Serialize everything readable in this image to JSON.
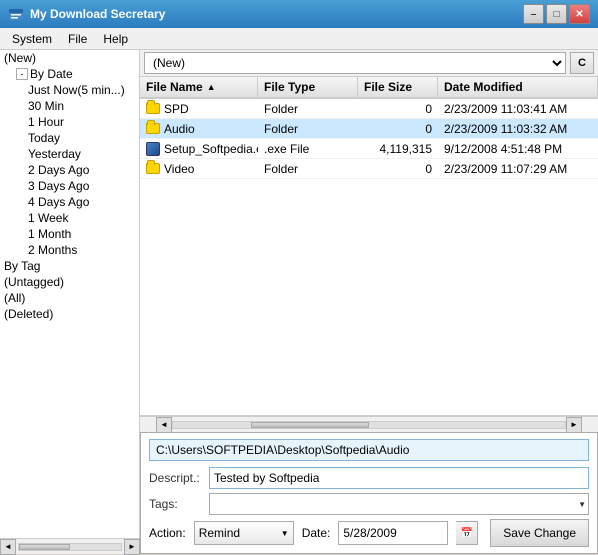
{
  "window": {
    "title": "My Download Secretary",
    "min_label": "–",
    "max_label": "□",
    "close_label": "✕"
  },
  "menu": {
    "items": [
      {
        "label": "System"
      },
      {
        "label": "File"
      },
      {
        "label": "Help"
      }
    ]
  },
  "toolbar": {
    "dropdown_value": "(New)",
    "c_button_label": "C"
  },
  "tree": {
    "items": [
      {
        "label": "(New)",
        "indent": 0,
        "type": "text"
      },
      {
        "label": "By Date",
        "indent": 0,
        "type": "expandable",
        "expanded": true
      },
      {
        "label": "Just Now(5 min...)",
        "indent": 2,
        "type": "text"
      },
      {
        "label": "30 Min",
        "indent": 2,
        "type": "text"
      },
      {
        "label": "1 Hour",
        "indent": 2,
        "type": "text"
      },
      {
        "label": "Today",
        "indent": 2,
        "type": "text"
      },
      {
        "label": "Yesterday",
        "indent": 2,
        "type": "text"
      },
      {
        "label": "2 Days Ago",
        "indent": 2,
        "type": "text"
      },
      {
        "label": "3 Days Ago",
        "indent": 2,
        "type": "text"
      },
      {
        "label": "4 Days Ago",
        "indent": 2,
        "type": "text"
      },
      {
        "label": "1 Week",
        "indent": 2,
        "type": "text"
      },
      {
        "label": "1 Month",
        "indent": 2,
        "type": "text"
      },
      {
        "label": "2 Months",
        "indent": 2,
        "type": "text"
      },
      {
        "label": "By Tag",
        "indent": 0,
        "type": "text"
      },
      {
        "label": "(Untagged)",
        "indent": 0,
        "type": "text"
      },
      {
        "label": "(All)",
        "indent": 0,
        "type": "text"
      },
      {
        "label": "(Deleted)",
        "indent": 0,
        "type": "text"
      }
    ]
  },
  "file_list": {
    "headers": [
      {
        "label": "File Name",
        "sort": "asc"
      },
      {
        "label": "File Type"
      },
      {
        "label": "File Size"
      },
      {
        "label": "Date Modified"
      }
    ],
    "rows": [
      {
        "name": "SPD",
        "type": "Folder",
        "size": "0",
        "date": "2/23/2009 11:03:41 AM",
        "icon": "folder"
      },
      {
        "name": "Audio",
        "type": "Folder",
        "size": "0",
        "date": "2/23/2009 11:03:32 AM",
        "icon": "folder",
        "selected": true
      },
      {
        "name": "Setup_Softpedia.exe",
        "type": ".exe File",
        "size": "4,119,315",
        "date": "9/12/2008 4:51:48 PM",
        "icon": "exe"
      },
      {
        "name": "Video",
        "type": "Folder",
        "size": "0",
        "date": "2/23/2009 11:07:29 AM",
        "icon": "folder"
      }
    ]
  },
  "bottom_panel": {
    "path": "C:\\Users\\SOFTPEDIA\\Desktop\\Softpedia\\Audio",
    "descript_label": "Descript.:",
    "descript_value": "Tested by Softpedia",
    "tags_label": "Tags:",
    "tags_value": "",
    "action_label": "Action:",
    "action_value": "Remind",
    "date_label": "Date:",
    "date_value": "5/28/2009",
    "save_button_label": "Save Change"
  }
}
